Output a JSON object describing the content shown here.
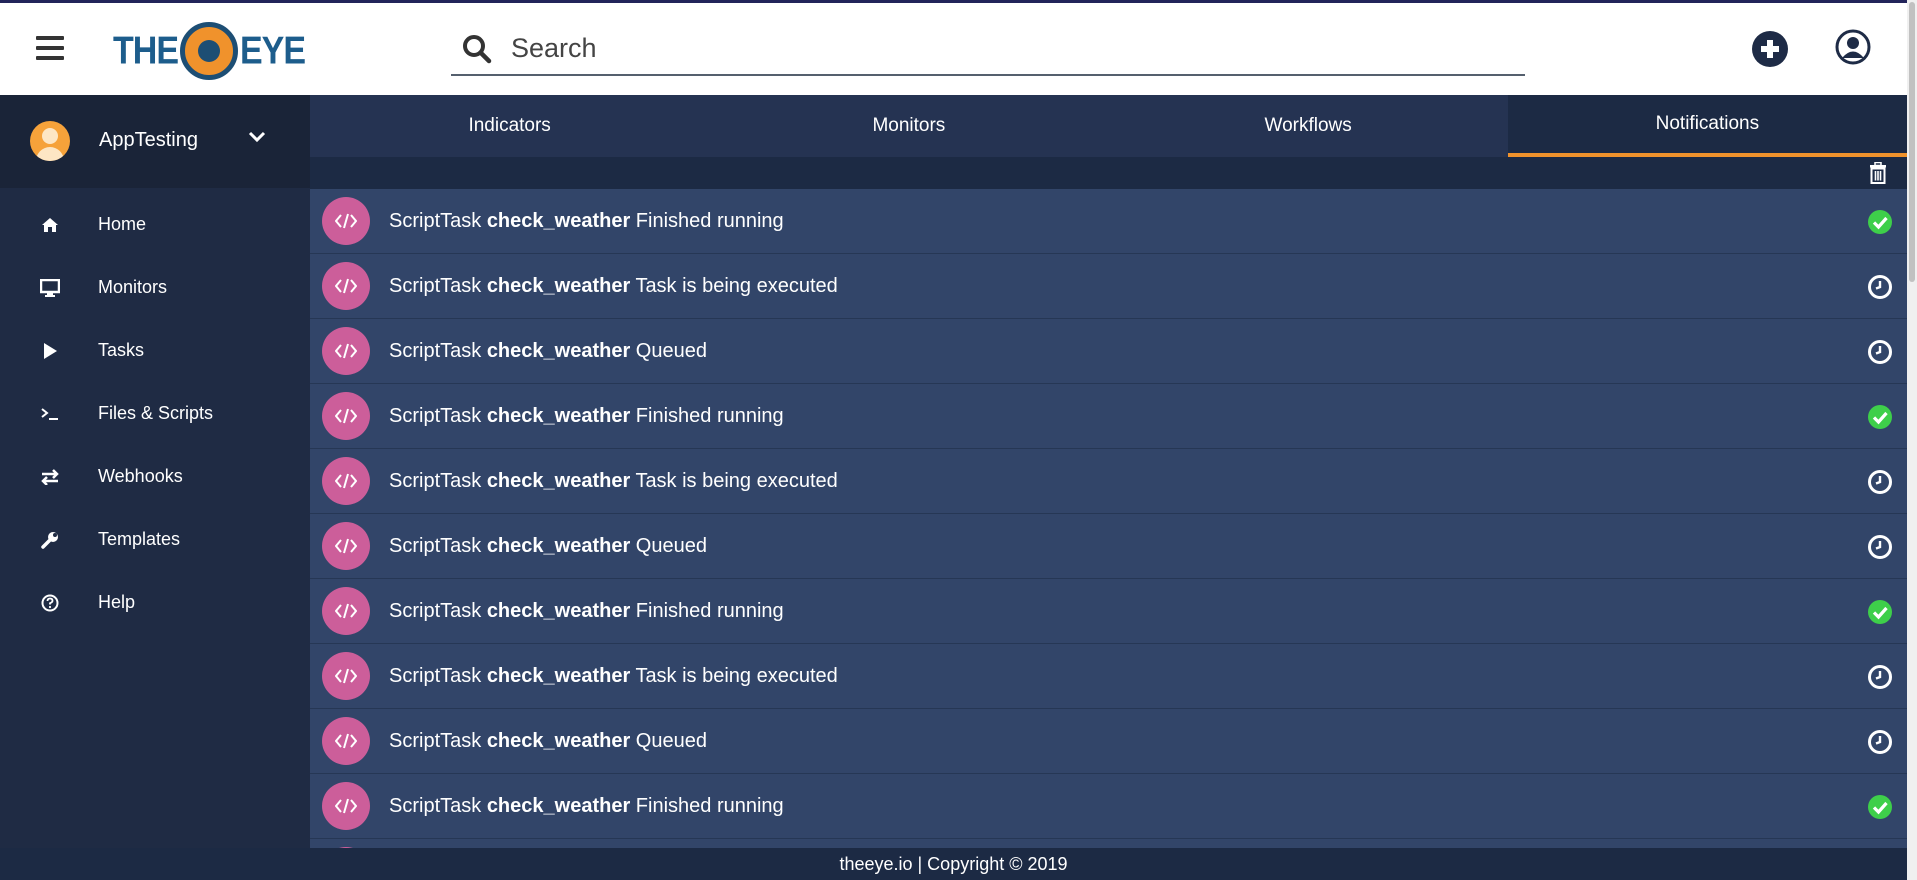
{
  "header": {
    "logo_text_left": "THE",
    "logo_text_right": "EYE",
    "search_placeholder": "Search"
  },
  "account": {
    "name": "AppTesting"
  },
  "sidebar": {
    "items": [
      {
        "label": "Home",
        "icon": "home-icon"
      },
      {
        "label": "Monitors",
        "icon": "monitor-icon"
      },
      {
        "label": "Tasks",
        "icon": "play-icon"
      },
      {
        "label": "Files & Scripts",
        "icon": "terminal-icon"
      },
      {
        "label": "Webhooks",
        "icon": "exchange-icon"
      },
      {
        "label": "Templates",
        "icon": "wrench-icon"
      },
      {
        "label": "Help",
        "icon": "question-icon"
      }
    ]
  },
  "tabs": [
    {
      "label": "Indicators"
    },
    {
      "label": "Monitors"
    },
    {
      "label": "Workflows"
    },
    {
      "label": "Notifications",
      "active": true
    }
  ],
  "notifications": [
    {
      "type": "ScriptTask",
      "name": "check_weather",
      "message": "Finished running",
      "status": "success"
    },
    {
      "type": "ScriptTask",
      "name": "check_weather",
      "message": "Task is being executed",
      "status": "pending"
    },
    {
      "type": "ScriptTask",
      "name": "check_weather",
      "message": "Queued",
      "status": "pending"
    },
    {
      "type": "ScriptTask",
      "name": "check_weather",
      "message": "Finished running",
      "status": "success"
    },
    {
      "type": "ScriptTask",
      "name": "check_weather",
      "message": "Task is being executed",
      "status": "pending"
    },
    {
      "type": "ScriptTask",
      "name": "check_weather",
      "message": "Queued",
      "status": "pending"
    },
    {
      "type": "ScriptTask",
      "name": "check_weather",
      "message": "Finished running",
      "status": "success"
    },
    {
      "type": "ScriptTask",
      "name": "check_weather",
      "message": "Task is being executed",
      "status": "pending"
    },
    {
      "type": "ScriptTask",
      "name": "check_weather",
      "message": "Queued",
      "status": "pending"
    },
    {
      "type": "ScriptTask",
      "name": "check_weather",
      "message": "Finished running",
      "status": "success"
    }
  ],
  "colors": {
    "accent": "#f0922c",
    "task_icon": "#cc5e9a",
    "success": "#3ecf4a"
  },
  "footer": {
    "text": "theeye.io | Copyright © 2019"
  }
}
